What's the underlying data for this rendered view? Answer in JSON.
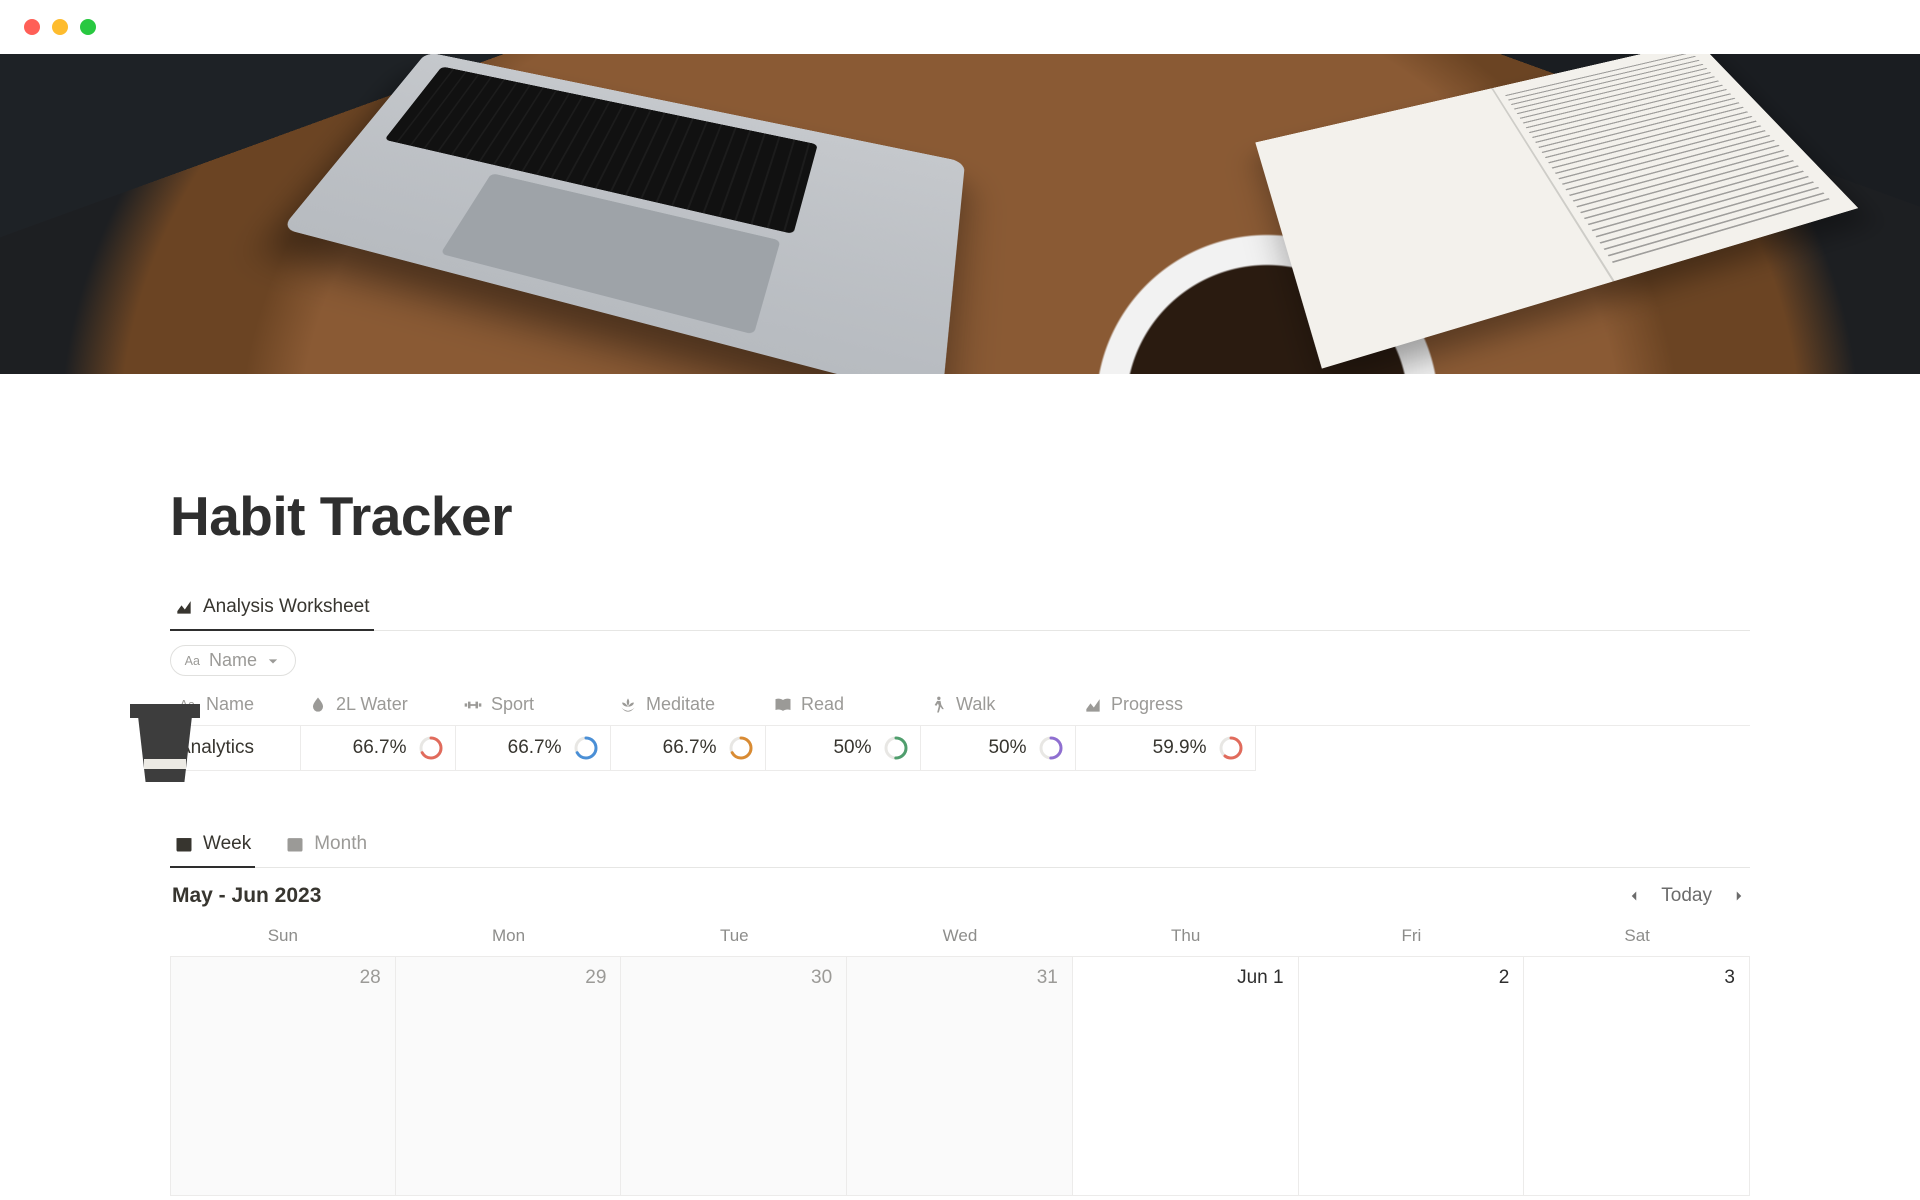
{
  "window": {
    "traffic_lights": [
      "close",
      "minimize",
      "zoom"
    ]
  },
  "cover": {
    "description": "Photo of a laptop, open book and coffee cup on a wooden table"
  },
  "page_icon": "to-go-cup-icon",
  "title": "Habit Tracker",
  "view_tabs_1": [
    {
      "icon": "chart-icon",
      "label": "Analysis Worksheet",
      "active": true
    }
  ],
  "filter_chips": [
    {
      "icon": "text-aa-icon",
      "label": "Name",
      "has_dropdown": true
    }
  ],
  "table": {
    "columns": [
      {
        "icon": "text-aa-icon",
        "label": "Name"
      },
      {
        "icon": "water-drop-icon",
        "label": "2L Water"
      },
      {
        "icon": "dumbbell-icon",
        "label": "Sport"
      },
      {
        "icon": "lotus-icon",
        "label": "Meditate"
      },
      {
        "icon": "book-icon",
        "label": "Read"
      },
      {
        "icon": "walk-icon",
        "label": "Walk"
      },
      {
        "icon": "chart-icon",
        "label": "Progress"
      }
    ],
    "rows": [
      {
        "name": "Analytics",
        "cells": [
          {
            "value": "66.7%",
            "pct": 66.7,
            "ring_color": "#e16b5c"
          },
          {
            "value": "66.7%",
            "pct": 66.7,
            "ring_color": "#4a8fd6"
          },
          {
            "value": "66.7%",
            "pct": 66.7,
            "ring_color": "#d98b33"
          },
          {
            "value": "50%",
            "pct": 50.0,
            "ring_color": "#4f9e6d"
          },
          {
            "value": "50%",
            "pct": 50.0,
            "ring_color": "#8f6fd1"
          },
          {
            "value": "59.9%",
            "pct": 59.9,
            "ring_color": "#e16b5c"
          }
        ]
      }
    ]
  },
  "view_tabs_2": [
    {
      "icon": "calendar-icon",
      "label": "Week",
      "active": true
    },
    {
      "icon": "calendar-icon",
      "label": "Month",
      "active": false
    }
  ],
  "calendar": {
    "range_label": "May - Jun 2023",
    "today_label": "Today",
    "day_names": [
      "Sun",
      "Mon",
      "Tue",
      "Wed",
      "Thu",
      "Fri",
      "Sat"
    ],
    "days": [
      {
        "label": "28",
        "outside": true
      },
      {
        "label": "29",
        "outside": true
      },
      {
        "label": "30",
        "outside": true
      },
      {
        "label": "31",
        "outside": true
      },
      {
        "label": "Jun 1",
        "outside": false
      },
      {
        "label": "2",
        "outside": false
      },
      {
        "label": "3",
        "outside": false
      }
    ]
  }
}
